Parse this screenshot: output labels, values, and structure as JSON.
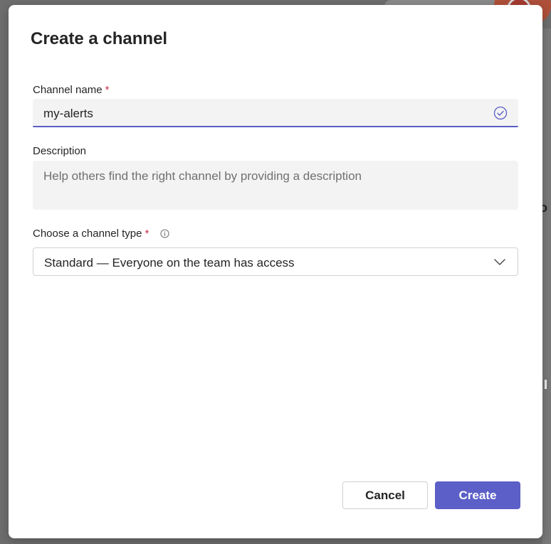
{
  "dialog": {
    "title": "Create a channel",
    "channel_name": {
      "label": "Channel name",
      "required_mark": "*",
      "value": "my-alerts",
      "status_icon": "checkmark-circle-icon"
    },
    "description": {
      "label": "Description",
      "placeholder": "Help others find the right channel by providing a description"
    },
    "channel_type": {
      "label": "Choose a channel type",
      "required_mark": "*",
      "info_icon": "info-icon",
      "selected": "Standard — Everyone on the team has access",
      "dropdown_icon": "chevron-down-icon"
    },
    "buttons": {
      "cancel": "Cancel",
      "create": "Create"
    }
  },
  "background": {
    "edge_text": "o"
  },
  "colors": {
    "accent": "#5b5fc7",
    "required": "#c4314b",
    "input_fill": "#f3f3f3"
  }
}
